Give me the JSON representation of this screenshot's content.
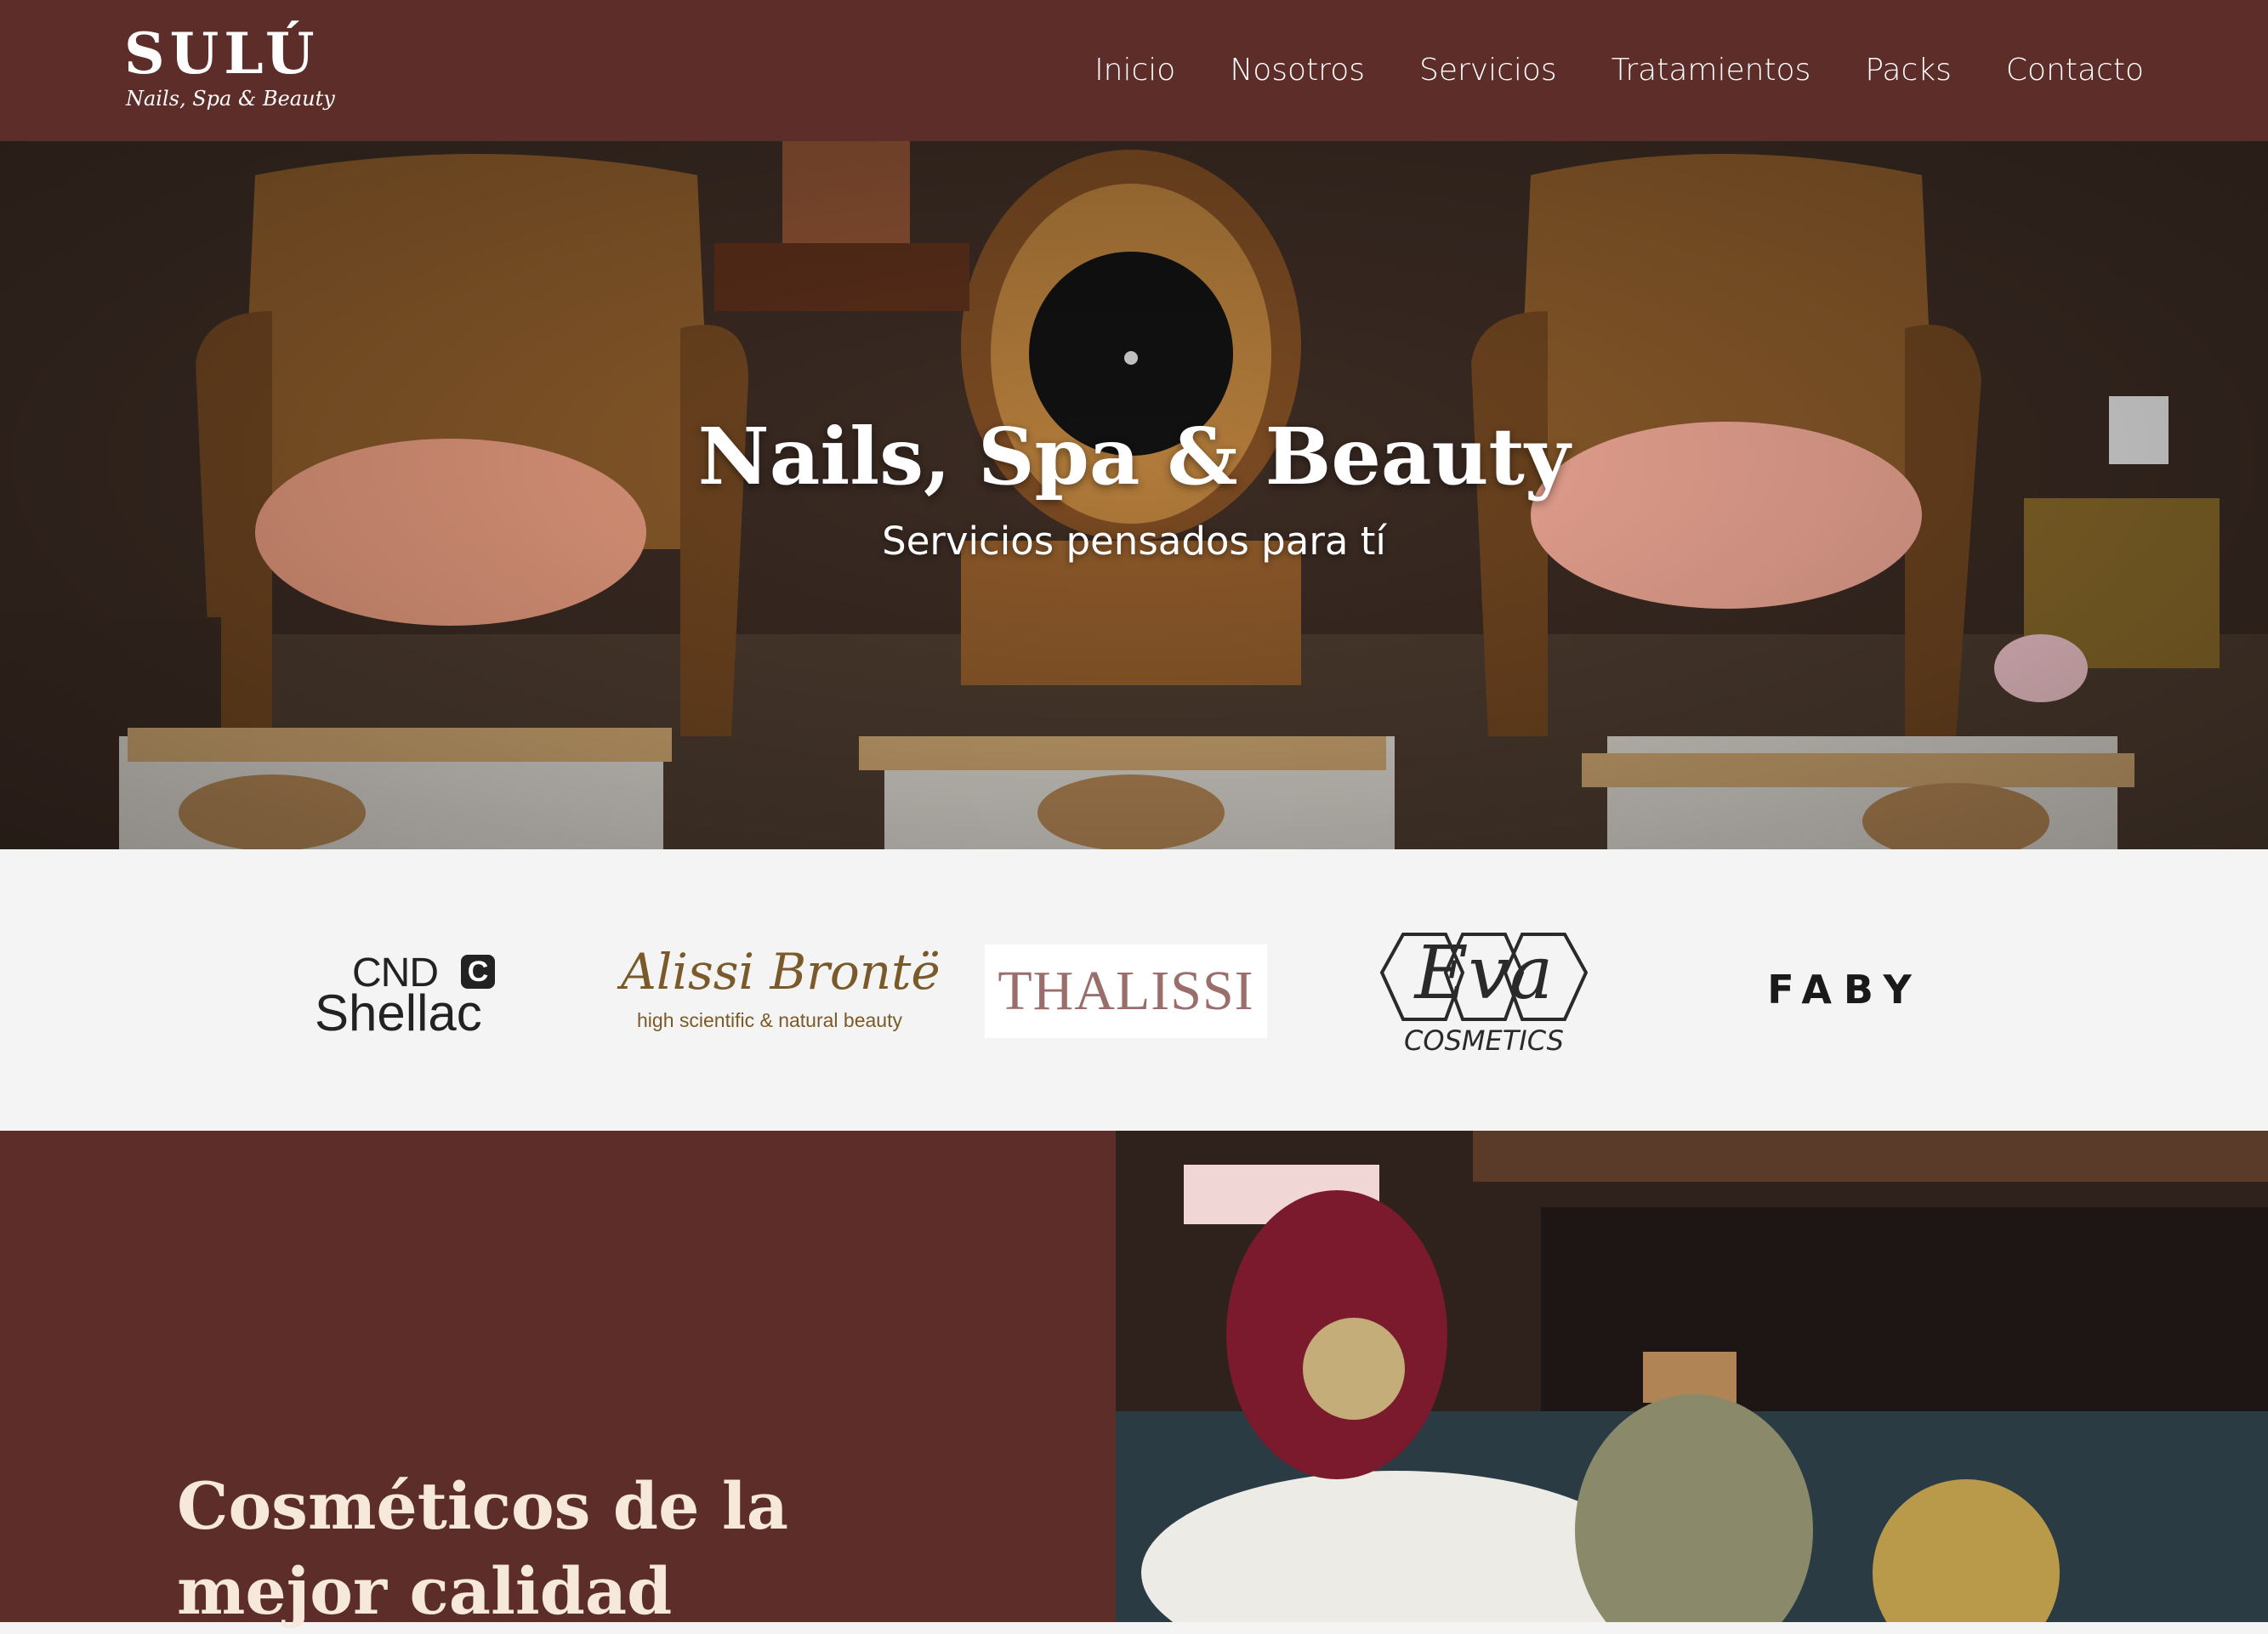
{
  "header": {
    "logo_main": "SULÚ",
    "logo_sub": "Nails, Spa & Beauty",
    "nav": [
      "Inicio",
      "Nosotros",
      "Servicios",
      "Tratamientos",
      "Packs",
      "Contacto"
    ]
  },
  "hero": {
    "title": "Nails, Spa & Beauty",
    "subtitle": "Servicios pensados para tí"
  },
  "brands": {
    "cnd_top": "CND",
    "cnd_bottom": "Shellac",
    "alissi_name": "Alissi Brontë",
    "alissi_tag": "high scientific & natural beauty",
    "thalissi": "THALISSI",
    "eva": "Eva",
    "eva_sub": "COSMETICS",
    "faby": "FABY"
  },
  "feature": {
    "title": "Cosméticos de la mejor calidad"
  },
  "colors": {
    "brand_maroon": "#5d2d29",
    "brands_bg": "#f4f4f4",
    "feature_title": "#f6e9dc"
  }
}
